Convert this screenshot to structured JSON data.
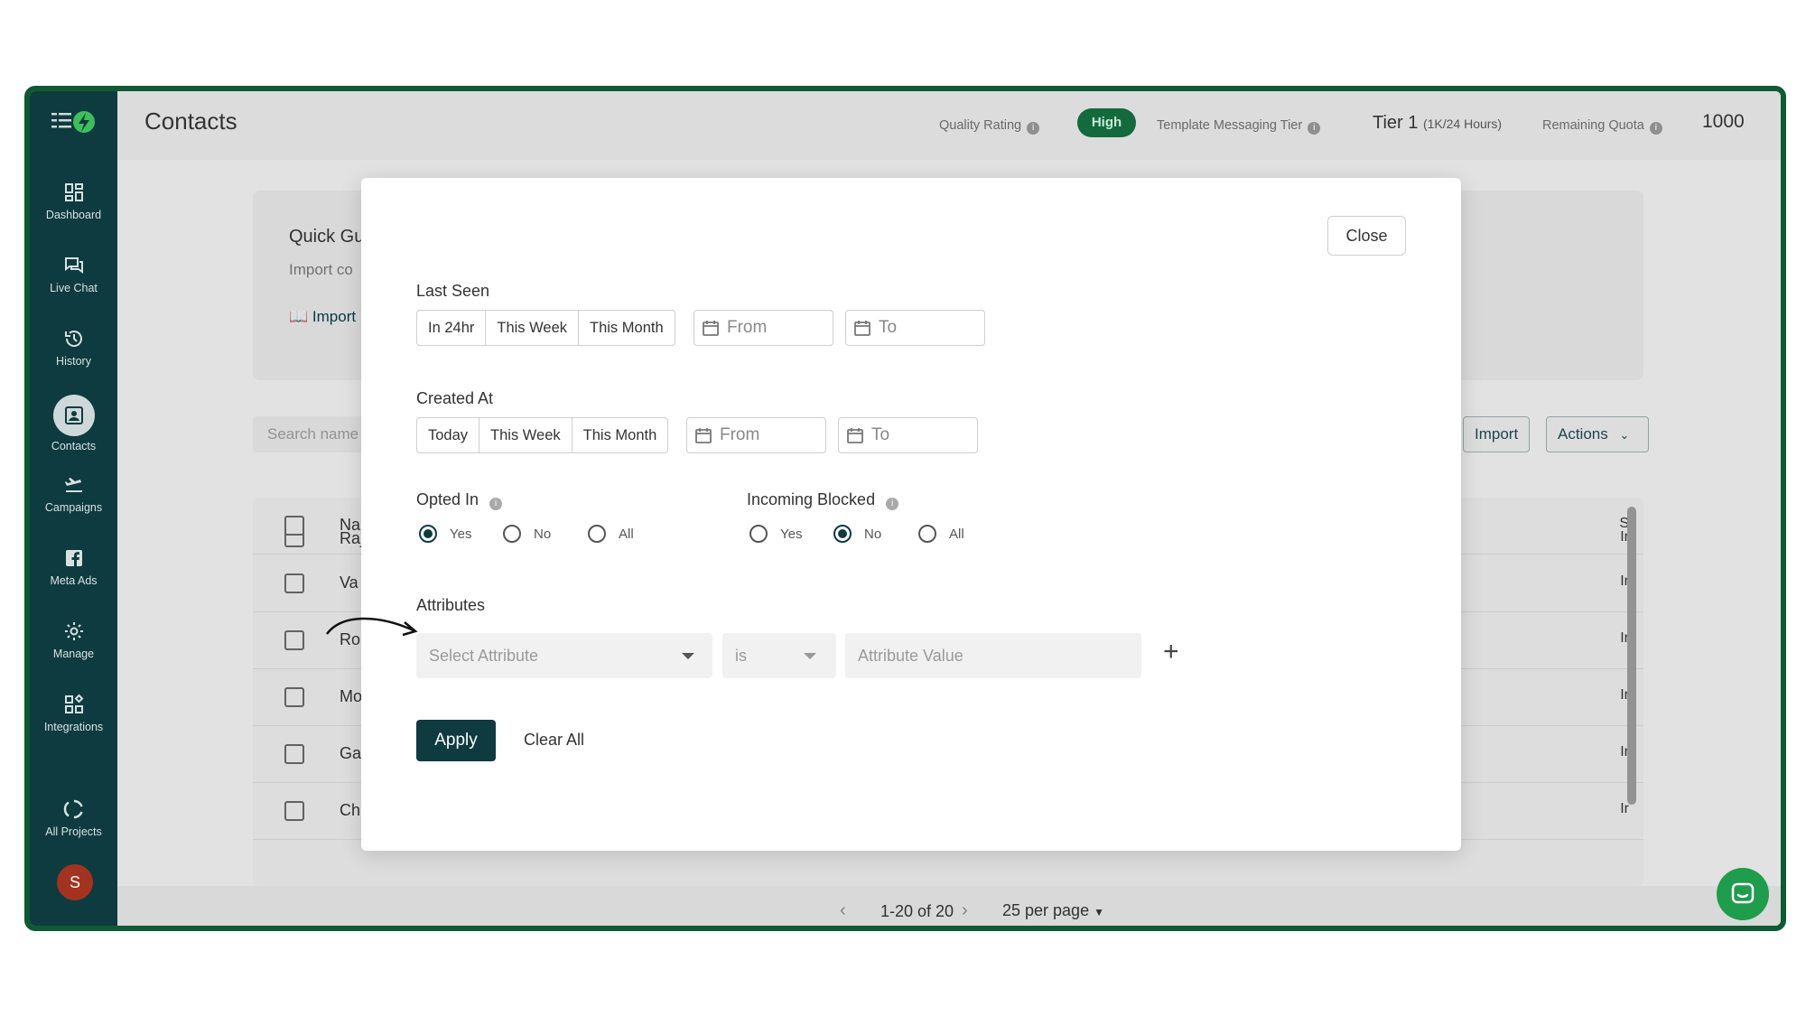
{
  "sidebar": {
    "items": [
      {
        "label": "Dashboard",
        "icon": "dashboard-icon"
      },
      {
        "label": "Live Chat",
        "icon": "chat-icon"
      },
      {
        "label": "History",
        "icon": "history-icon"
      },
      {
        "label": "Contacts",
        "icon": "contacts-icon"
      },
      {
        "label": "Campaigns",
        "icon": "campaigns-icon"
      },
      {
        "label": "Meta Ads",
        "icon": "facebook-icon"
      },
      {
        "label": "Manage",
        "icon": "gear-icon"
      },
      {
        "label": "Integrations",
        "icon": "integrations-icon"
      },
      {
        "label": "All Projects",
        "icon": "projects-icon"
      }
    ],
    "avatar_letter": "S"
  },
  "header": {
    "title": "Contacts",
    "quality_rating_label": "Quality Rating",
    "quality_rating_value": "High",
    "tier_label": "Template Messaging Tier",
    "tier_value": "Tier 1",
    "tier_detail": "(1K/24 Hours)",
    "quota_label": "Remaining Quota",
    "quota_value": "1000"
  },
  "background": {
    "quick_guide_title": "Quick Gu",
    "quick_guide_sub": "Import co",
    "quick_guide_link": "Import",
    "search_placeholder": "Search name",
    "import_button": "Import",
    "actions_button": "Actions",
    "table_header_name": "Na",
    "table_header_status": "S",
    "rows": [
      {
        "name": "Raj",
        "status": "Ir"
      },
      {
        "name": "Va",
        "status": "Ir"
      },
      {
        "name": "Ro",
        "status": "Ir"
      },
      {
        "name": "Mo",
        "status": "Ir"
      },
      {
        "name": "Ga",
        "status": "Ir"
      },
      {
        "name": "Ch",
        "status": "Ir"
      }
    ],
    "pagination": "1-20 of 20",
    "per_page": "25 per page"
  },
  "filter_modal": {
    "close_label": "Close",
    "last_seen": {
      "label": "Last Seen",
      "options": [
        "In 24hr",
        "This Week",
        "This Month"
      ],
      "from_placeholder": "From",
      "to_placeholder": "To"
    },
    "created_at": {
      "label": "Created At",
      "options": [
        "Today",
        "This Week",
        "This Month"
      ],
      "from_placeholder": "From",
      "to_placeholder": "To"
    },
    "opted_in": {
      "label": "Opted In",
      "options": [
        "Yes",
        "No",
        "All"
      ],
      "selected": "Yes"
    },
    "incoming_blocked": {
      "label": "Incoming Blocked",
      "options": [
        "Yes",
        "No",
        "All"
      ],
      "selected": "No"
    },
    "attributes": {
      "label": "Attributes",
      "attribute_placeholder": "Select Attribute",
      "operator_value": "is",
      "value_placeholder": "Attribute Value"
    },
    "apply_label": "Apply",
    "clear_label": "Clear All"
  },
  "colors": {
    "sidebar": "#0d3b40",
    "frame_border": "#0d5a35",
    "badge_high": "#126a3d",
    "primary_button": "#0d3b40",
    "chat_fab": "#1e9d4c"
  }
}
